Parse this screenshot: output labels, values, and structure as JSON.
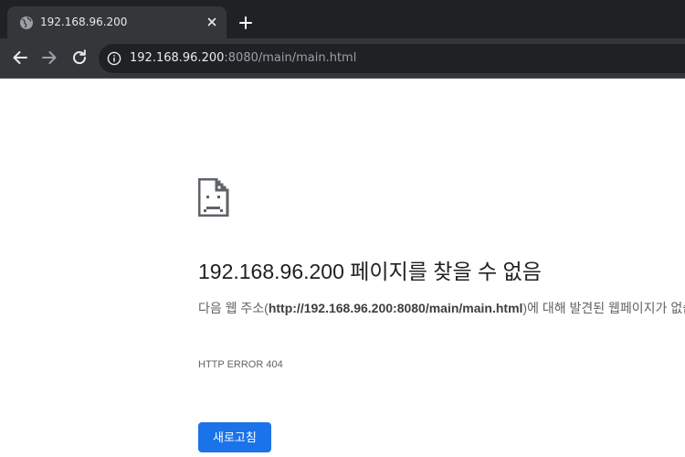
{
  "browser": {
    "tab": {
      "title": "192.168.96.200",
      "favicon": "globe-icon",
      "close": "close-icon"
    },
    "new_tab": "plus-icon",
    "toolbar": {
      "back": "back-arrow-icon",
      "forward": "forward-arrow-icon",
      "reload": "reload-icon",
      "site_info": "info-icon",
      "url_host": "192.168.96.200",
      "url_rest": ":8080/main/main.html"
    }
  },
  "error": {
    "icon": "sad-document-icon",
    "heading": "192.168.96.200 페이지를 찾을 수 없음",
    "desc_prefix": "다음 웹 주소(",
    "desc_url": "http://192.168.96.200:8080/main/main.html",
    "desc_suffix": ")에 대해 발견된 웹페이지가 없습니다.",
    "code": "HTTP ERROR 404",
    "reload_button": "새로고침"
  },
  "colors": {
    "tabstrip_bg": "#202124",
    "toolbar_bg": "#35363a",
    "accent": "#1a73e8",
    "heading_text": "#202124",
    "body_text": "#5f6368"
  }
}
